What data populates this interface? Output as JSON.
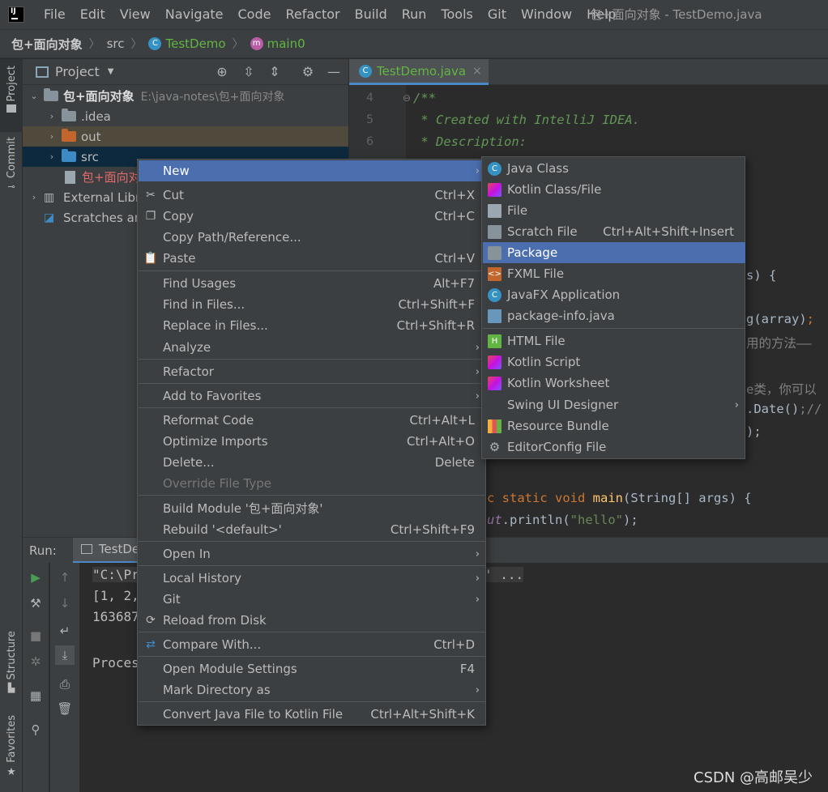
{
  "menubar": {
    "items": [
      {
        "label": "File",
        "key": "F"
      },
      {
        "label": "Edit",
        "key": "E"
      },
      {
        "label": "View",
        "key": "V"
      },
      {
        "label": "Navigate",
        "key": "N"
      },
      {
        "label": "Code",
        "key": "C"
      },
      {
        "label": "Refactor",
        "key": "R"
      },
      {
        "label": "Build",
        "key": "B"
      },
      {
        "label": "Run",
        "key": "u"
      },
      {
        "label": "Tools",
        "key": "T"
      },
      {
        "label": "Git",
        "key": "G"
      },
      {
        "label": "Window",
        "key": "W"
      },
      {
        "label": "Help",
        "key": "H"
      }
    ],
    "window_title": "包+面向对象 - TestDemo.java"
  },
  "breadcrumb": {
    "project": "包+面向对象",
    "folder": "src",
    "class": "TestDemo",
    "method": "main0"
  },
  "left_strip": {
    "project_tab": "Project",
    "commit_tab": "Commit",
    "structure_tab": "Structure",
    "favorites_tab": "Favorites"
  },
  "project_panel": {
    "title": "Project",
    "tree": [
      {
        "label": "包+面向对象",
        "path": "E:\\java-notes\\包+面向对象"
      },
      {
        "label": ".idea"
      },
      {
        "label": "out"
      },
      {
        "label": "src"
      },
      {
        "label": "包+面向对"
      },
      {
        "label": "External Libr"
      },
      {
        "label": "Scratches ar"
      }
    ]
  },
  "editor": {
    "tab_label": "TestDemo.java",
    "line_numbers": [
      "4",
      "5",
      "6"
    ],
    "code": {
      "l4": "/**",
      "l5": " * Created with IntelliJ IDEA.",
      "l6": " * Description:",
      "frag_s": "s) {",
      "frag_array_a": "g(array)",
      "frag_array_b": ";",
      "frag_cmt1": "用的方法——",
      "frag_cmt2": "e类，你可以",
      "frag_date_a": ".Date()",
      "frag_date_b": ";//",
      "frag_paren": ");",
      "main_kw": "c static void ",
      "main_fn": "main",
      "main_rest": "(String[] args) {",
      "println_ut": "ut",
      "println_rest": ".println(",
      "println_str": "\"hello\"",
      "println_end": ");"
    }
  },
  "run_panel": {
    "label": "Run:",
    "tab": "TestDem",
    "console": [
      "\"C:\\Pr",
      "[1, 2,",
      "163687",
      "",
      "Proces"
    ],
    "console_tail": "' ..."
  },
  "context_menu": {
    "items": [
      {
        "label": "New",
        "arrow": true
      },
      {
        "label": "Cut",
        "shortcut": "Ctrl+X"
      },
      {
        "label": "Copy",
        "shortcut": "Ctrl+C"
      },
      {
        "label": "Copy Path/Reference..."
      },
      {
        "label": "Paste",
        "shortcut": "Ctrl+V"
      },
      {
        "label": "Find Usages",
        "shortcut": "Alt+F7"
      },
      {
        "label": "Find in Files...",
        "shortcut": "Ctrl+Shift+F"
      },
      {
        "label": "Replace in Files...",
        "shortcut": "Ctrl+Shift+R"
      },
      {
        "label": "Analyze",
        "arrow": true
      },
      {
        "label": "Refactor",
        "arrow": true
      },
      {
        "label": "Add to Favorites",
        "arrow": true
      },
      {
        "label": "Reformat Code",
        "shortcut": "Ctrl+Alt+L"
      },
      {
        "label": "Optimize Imports",
        "shortcut": "Ctrl+Alt+O"
      },
      {
        "label": "Delete...",
        "shortcut": "Delete"
      },
      {
        "label": "Override File Type"
      },
      {
        "label": "Build Module '包+面向对象'"
      },
      {
        "label": "Rebuild '<default>'",
        "shortcut": "Ctrl+Shift+F9"
      },
      {
        "label": "Open In",
        "arrow": true
      },
      {
        "label": "Local History",
        "arrow": true
      },
      {
        "label": "Git",
        "arrow": true
      },
      {
        "label": "Reload from Disk"
      },
      {
        "label": "Compare With...",
        "shortcut": "Ctrl+D"
      },
      {
        "label": "Open Module Settings",
        "shortcut": "F4"
      },
      {
        "label": "Mark Directory as",
        "arrow": true
      },
      {
        "label": "Convert Java File to Kotlin File",
        "shortcut": "Ctrl+Alt+Shift+K"
      }
    ]
  },
  "sub_menu": {
    "items": [
      {
        "label": "Java Class",
        "icon": "java-class-icon"
      },
      {
        "label": "Kotlin Class/File",
        "icon": "kotlin-file-icon"
      },
      {
        "label": "File",
        "icon": "file-icon"
      },
      {
        "label": "Scratch File",
        "shortcut": "Ctrl+Alt+Shift+Insert",
        "icon": "scratch-file-icon"
      },
      {
        "label": "Package",
        "icon": "package-icon"
      },
      {
        "label": "FXML File",
        "icon": "fxml-icon"
      },
      {
        "label": "JavaFX Application",
        "icon": "javafx-icon"
      },
      {
        "label": "package-info.java",
        "icon": "package-info-icon"
      },
      {
        "label": "HTML File",
        "icon": "html-icon"
      },
      {
        "label": "Kotlin Script",
        "icon": "kotlin-script-icon"
      },
      {
        "label": "Kotlin Worksheet",
        "icon": "kotlin-worksheet-icon"
      },
      {
        "label": "Swing UI Designer",
        "arrow": true
      },
      {
        "label": "Resource Bundle",
        "icon": "resource-bundle-icon"
      },
      {
        "label": "EditorConfig File",
        "icon": "gear-icon"
      }
    ]
  },
  "icons": {
    "java_class": "C",
    "method": "m",
    "play": "▶",
    "wrench": "🔧",
    "stop": "■",
    "chevron_right": "›",
    "chevron_down": "⌄",
    "close": "×"
  },
  "colors": {
    "highlight": "#4b6eaf",
    "background": "#2b2b2b",
    "panel": "#3c3f41",
    "doc_comment": "#629755",
    "keyword": "#cc7832",
    "function": "#ffc66d",
    "string": "#6a8759"
  },
  "watermark": "CSDN @高邮吴少"
}
